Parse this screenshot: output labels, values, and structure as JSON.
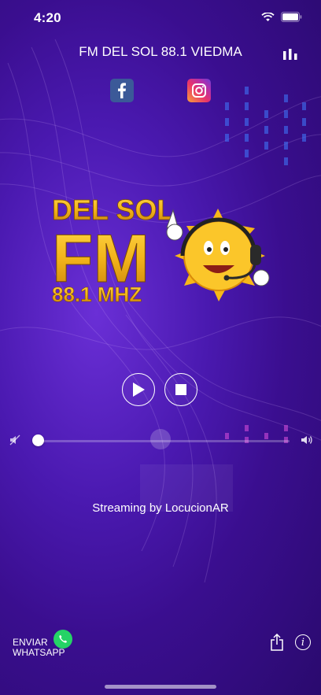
{
  "status_bar": {
    "time": "4:20"
  },
  "header": {
    "title": "FM DEL SOL 88.1 VIEDMA"
  },
  "social": {
    "facebook_icon": "facebook-icon",
    "instagram_icon": "instagram-icon"
  },
  "logo": {
    "line1": "DEL SOL",
    "line2": "FM",
    "line3": "88.1 MHZ"
  },
  "player": {
    "play_icon": "play-icon",
    "stop_icon": "stop-icon",
    "volume_level": 0.02
  },
  "footer": {
    "streaming_text": "Streaming by LocucionAR",
    "whatsapp_line1": "ENVIAR",
    "whatsapp_line2": "WHATSAPP"
  },
  "colors": {
    "accent_purple": "#4a19b0",
    "whatsapp_green": "#25d366",
    "logo_gold": "#f2b31a"
  }
}
